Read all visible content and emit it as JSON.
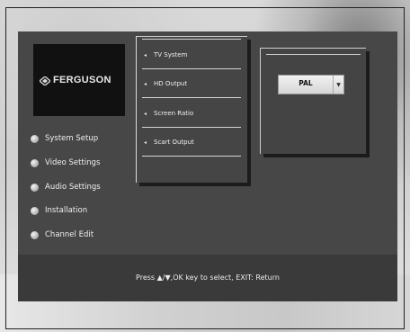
{
  "logo": {
    "text": "FERGUSON"
  },
  "main_menu": {
    "items": [
      {
        "label": "System Setup"
      },
      {
        "label": "Video Settings"
      },
      {
        "label": "Audio Settings"
      },
      {
        "label": "Installation"
      },
      {
        "label": "Channel Edit"
      }
    ]
  },
  "video_menu": {
    "items": [
      {
        "label": "TV System"
      },
      {
        "label": "HD Output"
      },
      {
        "label": "Screen Ratio"
      },
      {
        "label": "Scart Output"
      }
    ]
  },
  "tv_system_select": {
    "value": "PAL"
  },
  "footer": {
    "hint": "Press ▲/▼,OK key to select, EXIT: Return"
  }
}
